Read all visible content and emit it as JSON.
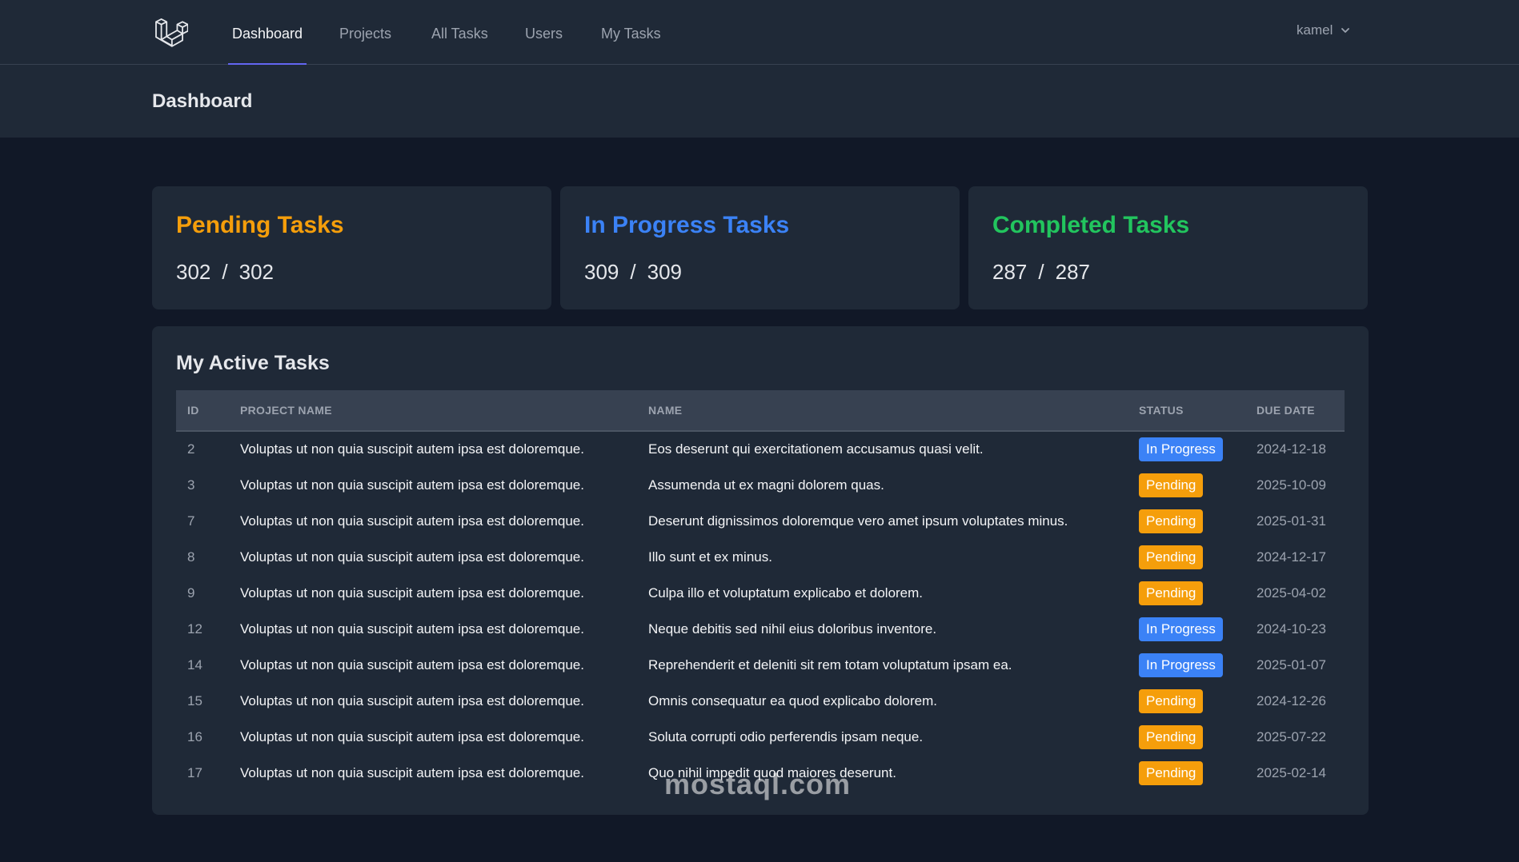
{
  "nav": {
    "links": [
      "Dashboard",
      "Projects",
      "All Tasks",
      "Users",
      "My Tasks"
    ],
    "active": "Dashboard",
    "user": "kamel"
  },
  "header": {
    "title": "Dashboard"
  },
  "stats": [
    {
      "title": "Pending Tasks",
      "count": "302",
      "total": "302",
      "color": "#f59e0b"
    },
    {
      "title": "In Progress Tasks",
      "count": "309",
      "total": "309",
      "color": "#3b82f6"
    },
    {
      "title": "Completed Tasks",
      "count": "287",
      "total": "287",
      "color": "#22c55e"
    }
  ],
  "tasks": {
    "title": "My Active Tasks",
    "columns": [
      "ID",
      "Project Name",
      "Name",
      "Status",
      "Due Date"
    ],
    "rows": [
      {
        "id": "2",
        "project": "Voluptas ut non quia suscipit autem ipsa est doloremque.",
        "name": "Eos deserunt qui exercitationem accusamus quasi velit.",
        "status": "In Progress",
        "due": "2024-12-18"
      },
      {
        "id": "3",
        "project": "Voluptas ut non quia suscipit autem ipsa est doloremque.",
        "name": "Assumenda ut ex magni dolorem quas.",
        "status": "Pending",
        "due": "2025-10-09"
      },
      {
        "id": "7",
        "project": "Voluptas ut non quia suscipit autem ipsa est doloremque.",
        "name": "Deserunt dignissimos doloremque vero amet ipsum voluptates minus.",
        "status": "Pending",
        "due": "2025-01-31"
      },
      {
        "id": "8",
        "project": "Voluptas ut non quia suscipit autem ipsa est doloremque.",
        "name": "Illo sunt et ex minus.",
        "status": "Pending",
        "due": "2024-12-17"
      },
      {
        "id": "9",
        "project": "Voluptas ut non quia suscipit autem ipsa est doloremque.",
        "name": "Culpa illo et voluptatum explicabo et dolorem.",
        "status": "Pending",
        "due": "2025-04-02"
      },
      {
        "id": "12",
        "project": "Voluptas ut non quia suscipit autem ipsa est doloremque.",
        "name": "Neque debitis sed nihil eius doloribus inventore.",
        "status": "In Progress",
        "due": "2024-10-23"
      },
      {
        "id": "14",
        "project": "Voluptas ut non quia suscipit autem ipsa est doloremque.",
        "name": "Reprehenderit et deleniti sit rem totam voluptatum ipsam ea.",
        "status": "In Progress",
        "due": "2025-01-07"
      },
      {
        "id": "15",
        "project": "Voluptas ut non quia suscipit autem ipsa est doloremque.",
        "name": "Omnis consequatur ea quod explicabo dolorem.",
        "status": "Pending",
        "due": "2024-12-26"
      },
      {
        "id": "16",
        "project": "Voluptas ut non quia suscipit autem ipsa est doloremque.",
        "name": "Soluta corrupti odio perferendis ipsam neque.",
        "status": "Pending",
        "due": "2025-07-22"
      },
      {
        "id": "17",
        "project": "Voluptas ut non quia suscipit autem ipsa est doloremque.",
        "name": "Quo nihil impedit quod maiores deserunt.",
        "status": "Pending",
        "due": "2025-02-14"
      }
    ]
  },
  "status_colors": {
    "Pending": "#f59e0b",
    "In Progress": "#3b82f6"
  },
  "watermark": "mostaql.com"
}
